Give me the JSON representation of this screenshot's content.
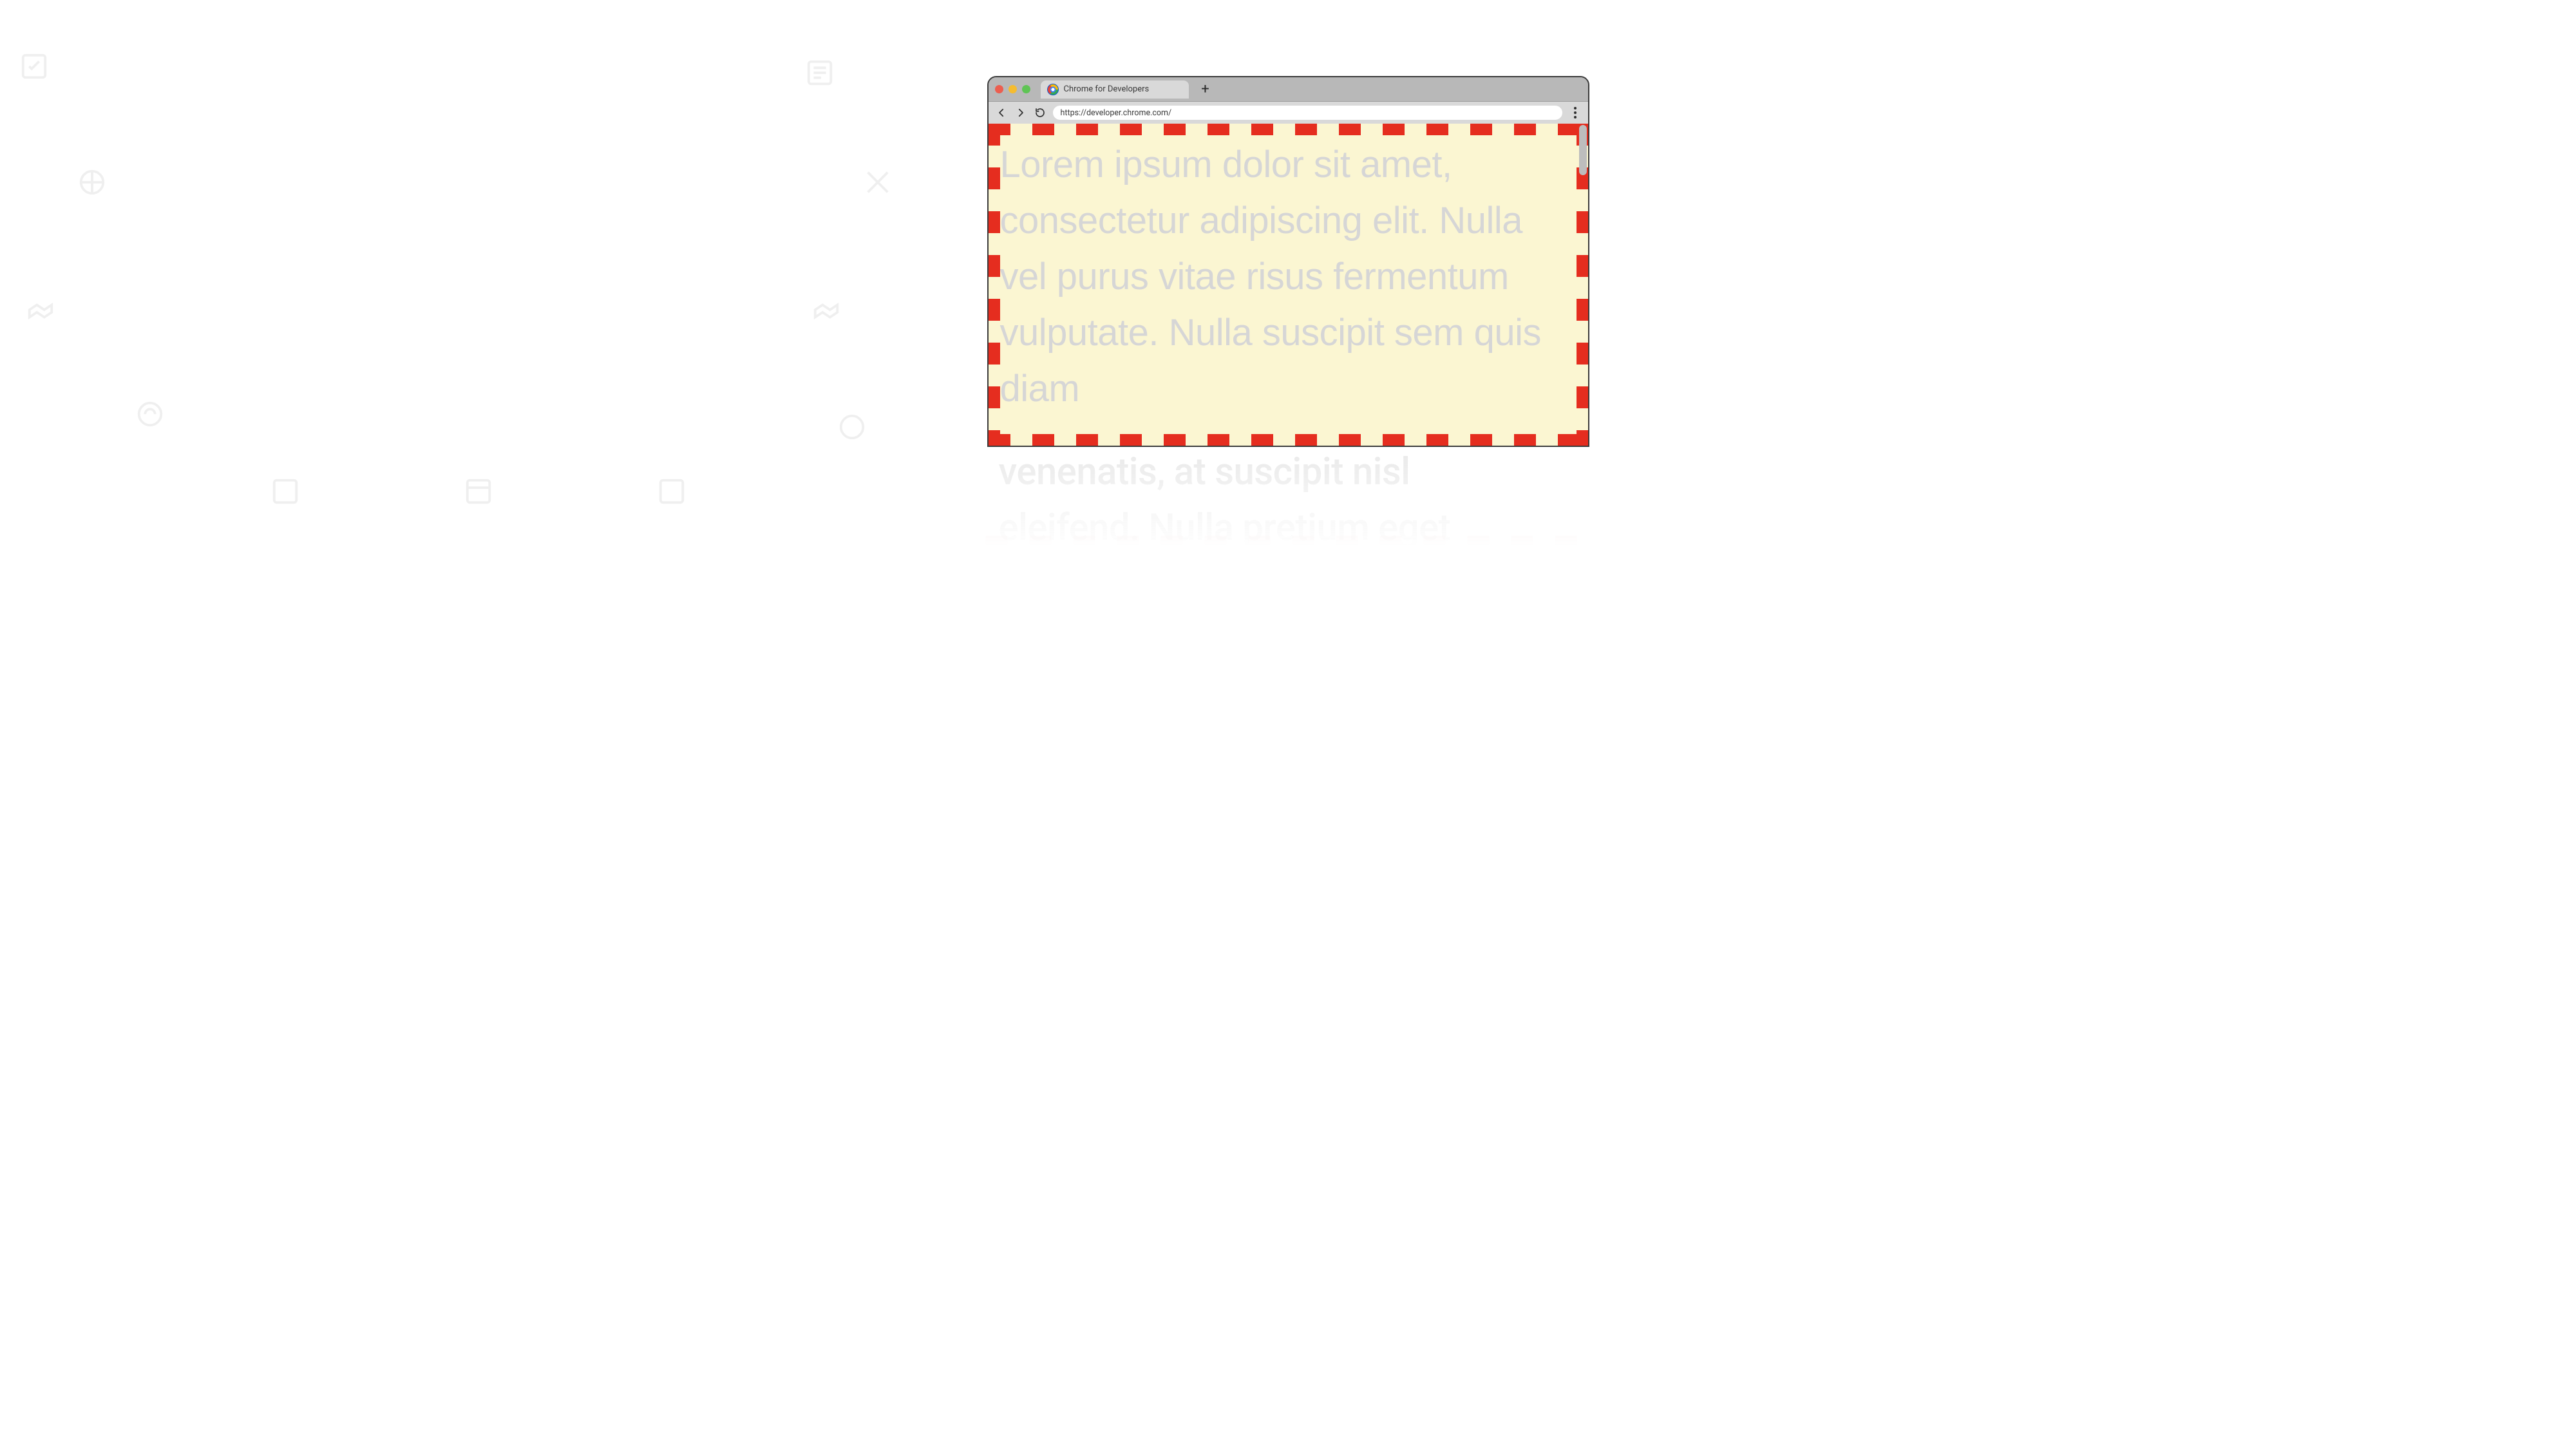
{
  "tab": {
    "title": "Chrome for Developers"
  },
  "omnibox": {
    "url": "https://developer.chrome.com/"
  },
  "content": {
    "body_text": "Lorem ipsum dolor sit amet, consectetur adipiscing elit. Nulla vel purus vitae risus fermentum vulputate. Nulla suscipit sem quis diam",
    "overflow_line1": "venenatis, at suscipit nisl",
    "overflow_line2": "eleifend. Nulla pretium eget"
  },
  "colors": {
    "dash_border": "#e52d1f",
    "page_bg": "#fbf6d2",
    "text_placeholder": "#d6d6d6"
  }
}
